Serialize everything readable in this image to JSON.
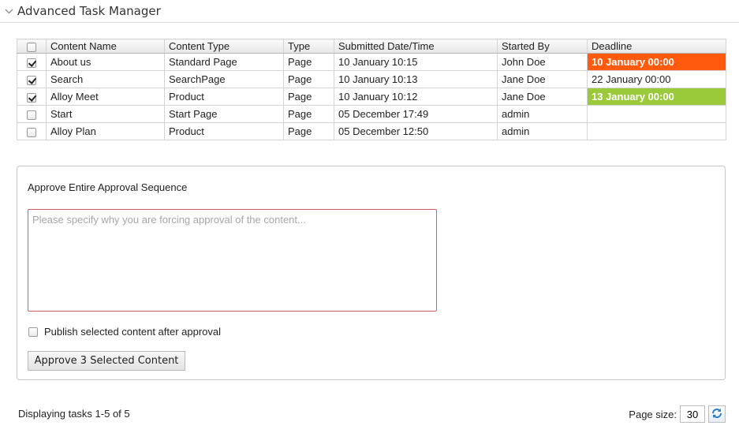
{
  "header": {
    "title": "Advanced Task Manager"
  },
  "grid": {
    "columns": [
      "Content Name",
      "Content Type",
      "Type",
      "Submitted Date/Time",
      "Started By",
      "Deadline"
    ],
    "rows": [
      {
        "name": "About us",
        "content_type": "Standard Page",
        "type": "Page",
        "submitted": "10 January 10:15",
        "started_by": "John Doe",
        "deadline": "10 January 00:00",
        "checked": true
      },
      {
        "name": "Search",
        "content_type": "SearchPage",
        "type": "Page",
        "submitted": "10 January 10:13",
        "started_by": "Jane Doe",
        "deadline": "22 January 00:00",
        "checked": true
      },
      {
        "name": "Alloy Meet",
        "content_type": "Product",
        "type": "Page",
        "submitted": "10 January 10:12",
        "started_by": "Jane Doe",
        "deadline": "13 January 00:00",
        "checked": true
      },
      {
        "name": "Start",
        "content_type": "Start Page",
        "type": "Page",
        "submitted": "05 December 17:49",
        "started_by": "admin",
        "deadline": "",
        "checked": false
      },
      {
        "name": "Alloy Plan",
        "content_type": "Product",
        "type": "Page",
        "submitted": "05 December 12:50",
        "started_by": "admin",
        "deadline": "",
        "checked": false
      }
    ]
  },
  "approval": {
    "title": "Approve Entire Approval Sequence",
    "comment_placeholder": "Please specify why you are forcing approval of the content...",
    "comment_value": "",
    "publish_label": "Publish selected content after approval",
    "publish_checked": false,
    "approve_button": "Approve 3 Selected Content"
  },
  "footer": {
    "status": "Displaying tasks 1-5 of 5",
    "page_size_label": "Page size:",
    "page_size": "30"
  },
  "icons": {
    "collapse": "chevron-down-icon",
    "refresh": "refresh-icon"
  },
  "colors": {
    "overdue": "#ff5a0d",
    "on_time": "#9ac93a"
  }
}
